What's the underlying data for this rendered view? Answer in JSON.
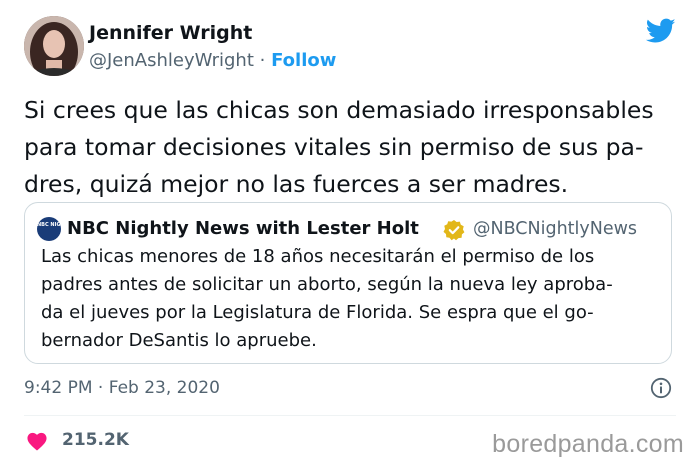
{
  "author": {
    "name": "Jennifer Wright",
    "handle": "@JenAshleyWright",
    "separator": "·",
    "follow_label": "Follow"
  },
  "icons": {
    "brand": "twitter-bird-icon",
    "verified": "verified-badge-icon",
    "info": "info-icon",
    "like": "heart-icon"
  },
  "colors": {
    "accent": "#1d9bf0",
    "like": "#f91880",
    "verified_badge": "#e2b719",
    "secondary_text": "#536471"
  },
  "tweet": {
    "text": "Si crees que las chicas son demasiado irresponsables para tomar decisiones vitales sin permiso de sus pa-dres, quizá mejor no las fuerces a ser madres.",
    "lines": [
      "Si crees que las chicas son demasiado irresponsables",
      "para tomar decisiones vitales sin permiso de sus pa-",
      "dres, quizá mejor no las fuerces a ser madres."
    ],
    "time": "9:42 PM",
    "date": "Feb 23, 2020",
    "likes": "215.2K"
  },
  "quoted": {
    "logo_text": "NBC NIGHTLY NEWS",
    "name": "NBC Nightly News with Lester Holt",
    "handle": "@NBCNightlyNews",
    "lines": [
      "Las chicas menores de 18 años necesitarán el permiso de los",
      "padres antes de solicitar un aborto, según la nueva ley aproba-",
      "da el jueves por la Legislatura de Florida. Se espra que el go-",
      "bernador DeSantis lo apruebe."
    ]
  },
  "watermark": "boredpanda.com"
}
